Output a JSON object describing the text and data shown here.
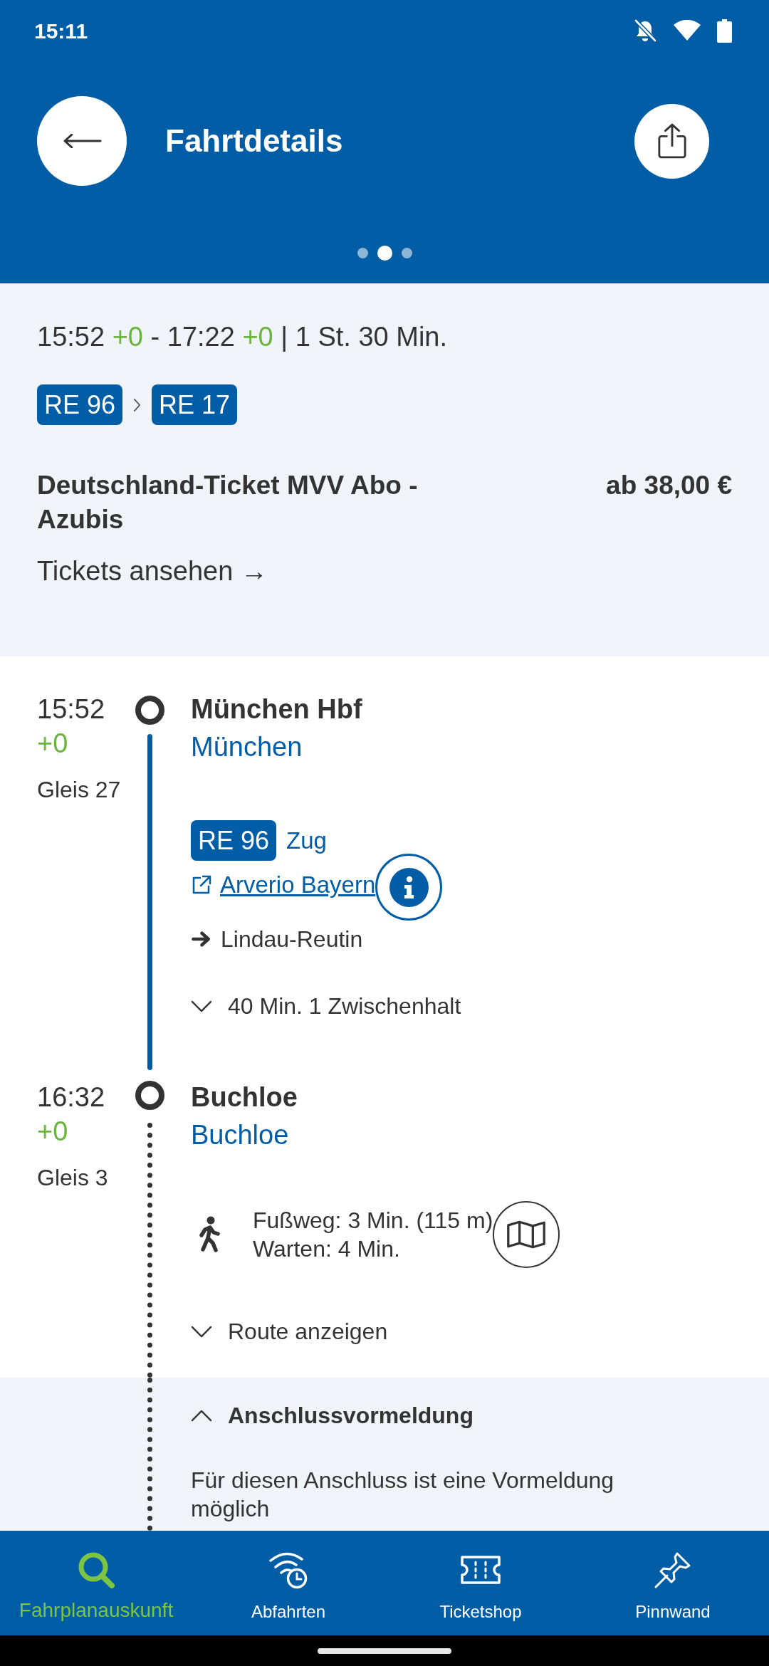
{
  "status_bar": {
    "time": "15:11"
  },
  "header": {
    "title": "Fahrtdetails"
  },
  "pager": [
    {
      "selected": false
    },
    {
      "selected": true
    },
    {
      "selected": false
    }
  ],
  "summary": {
    "segments": [
      {
        "kind": "plain",
        "text": "15:52"
      },
      {
        "kind": "delay",
        "text": "+0"
      },
      {
        "kind": "plain",
        "text": "-"
      },
      {
        "kind": "plain",
        "text": "17:22"
      },
      {
        "kind": "delay",
        "text": "+0"
      },
      {
        "kind": "plain",
        "text": "| 1 St. 30 Min."
      }
    ],
    "products": [
      "RE 96",
      "RE 17"
    ],
    "ticket": {
      "name": "Deutschland-Ticket MVV Abo - Azubis",
      "price": "ab 38,00 €",
      "link": "Tickets ansehen →"
    }
  },
  "stops": [
    {
      "time": "15:52",
      "delay": "+0",
      "platform": "Gleis 27",
      "name": "München Hbf",
      "place": "München",
      "leg": {
        "kind": "train",
        "product": "RE 96",
        "mode": "Zug",
        "operator": "Arverio Bayern",
        "direction": "Lindau-Reutin",
        "toggle": {
          "label": "40 Min. 1 Zwischenhalt",
          "expanded": false
        }
      }
    },
    {
      "time": "16:32",
      "delay": "+0",
      "platform": "Gleis 3",
      "name": "Buchloe",
      "place": "Buchloe",
      "leg": {
        "kind": "walk",
        "lines": [
          "Fußweg: 3 Min. (115 m)",
          "Warten: 4 Min."
        ],
        "toggle": {
          "label": "Route anzeigen",
          "expanded": false
        },
        "notice": {
          "title": "Anschlussvormeldung",
          "expanded": true,
          "text": "Für diesen Anschluss ist eine Vormeldung möglich"
        }
      }
    }
  ],
  "bottom_nav": [
    {
      "label": "Fahrplanauskunft",
      "selected": true
    },
    {
      "label": "Abfahrten",
      "selected": false
    },
    {
      "label": "Ticketshop",
      "selected": false
    },
    {
      "label": "Pinnwand",
      "selected": false
    }
  ]
}
